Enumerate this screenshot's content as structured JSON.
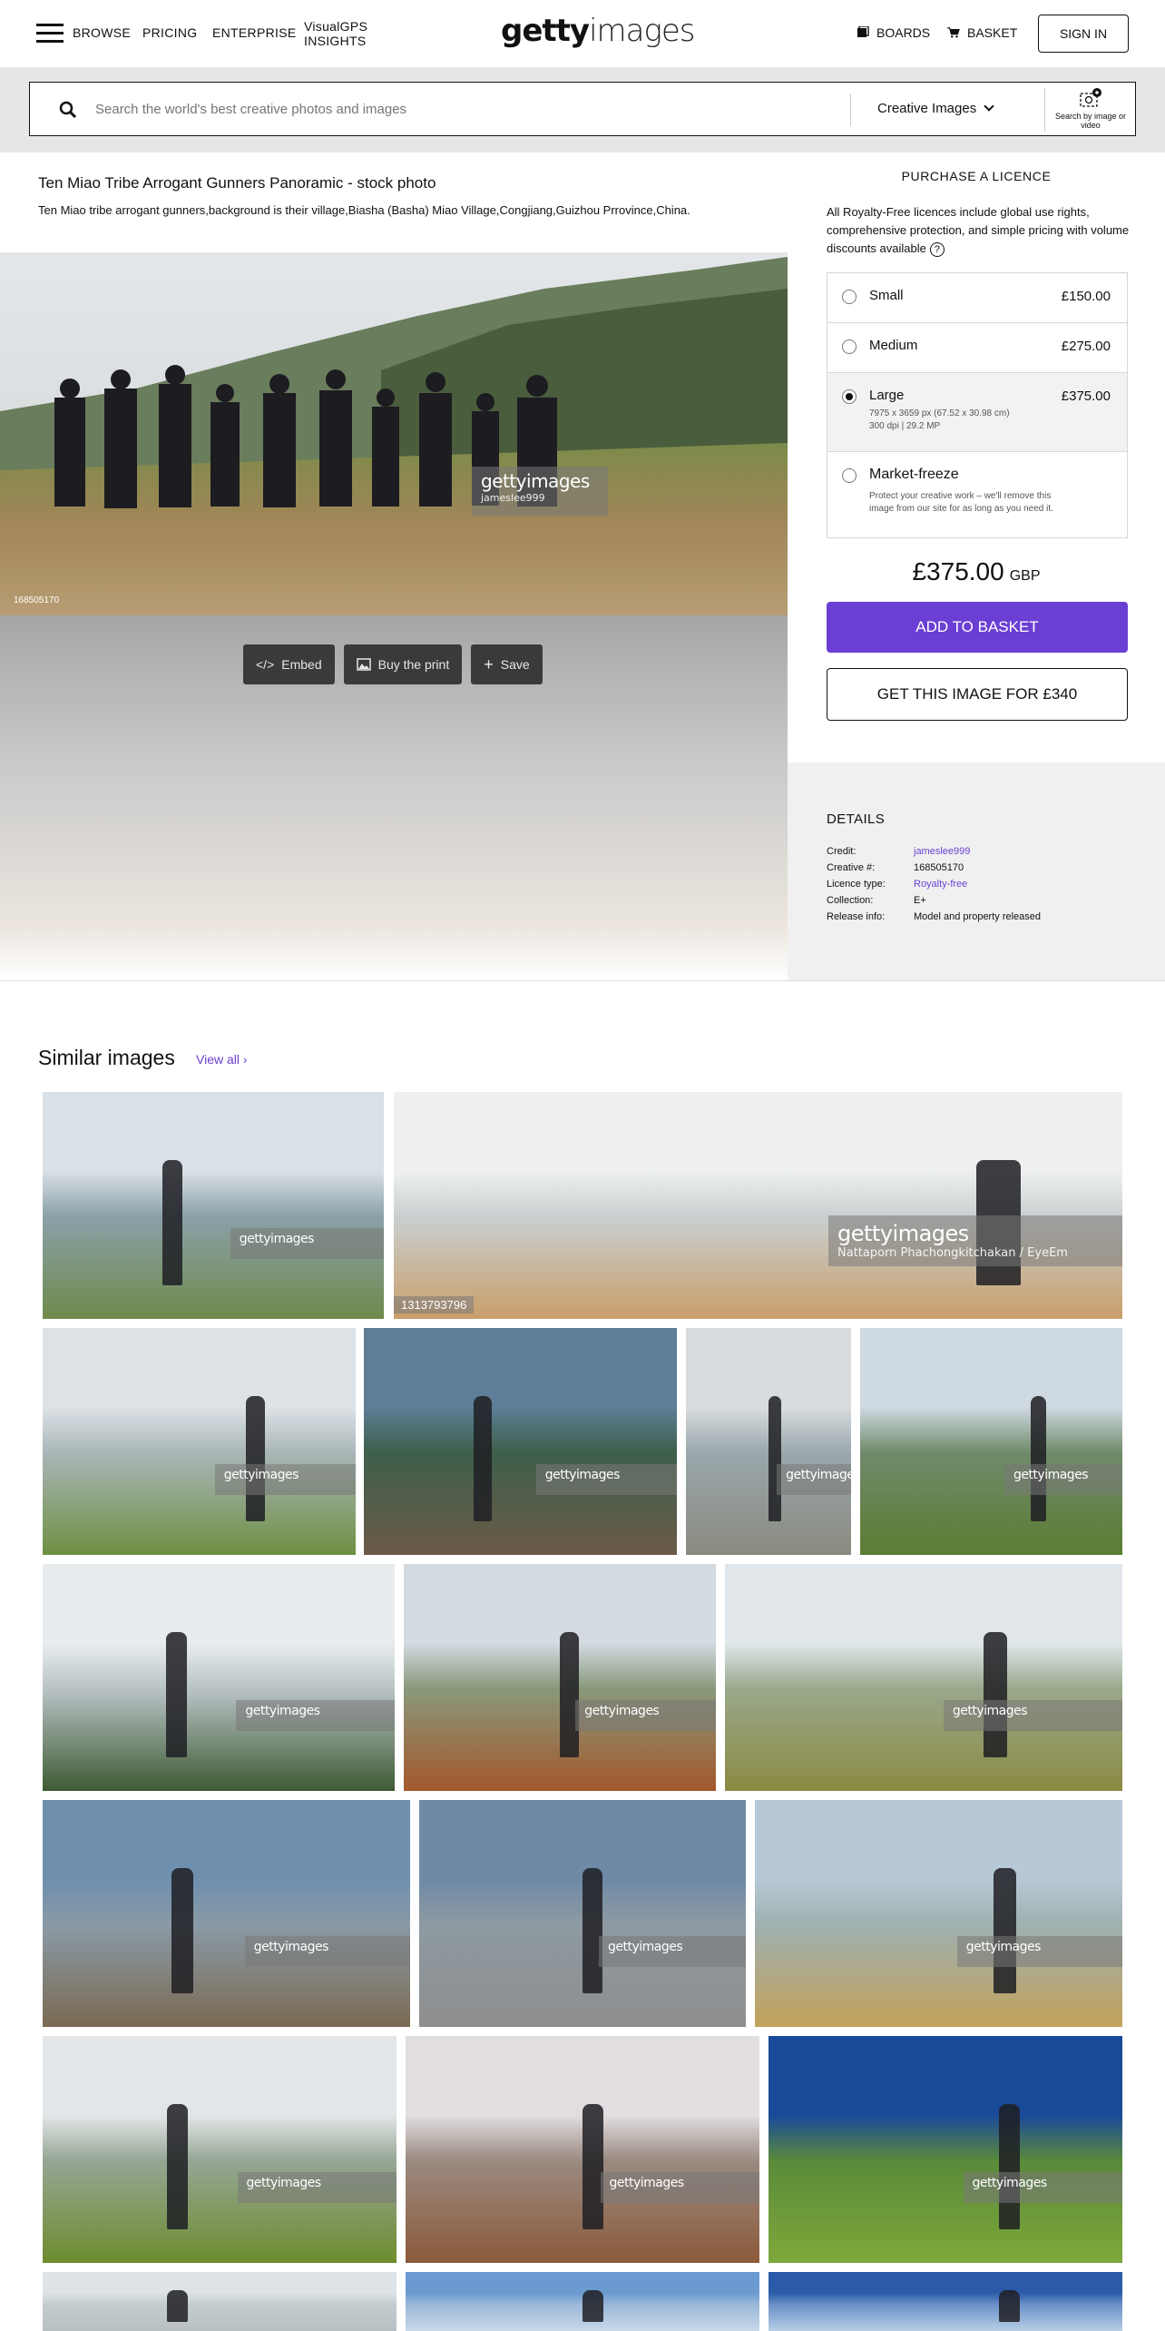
{
  "header": {
    "browse": "BROWSE",
    "pricing": "PRICING",
    "enterprise": "ENTERPRISE",
    "insights": "VisualGPS INSIGHTS",
    "logo_bold": "getty",
    "logo_light": "images",
    "boards": "BOARDS",
    "basket": "BASKET",
    "signin": "SIGN IN"
  },
  "search": {
    "placeholder": "Search the world's best creative photos and images",
    "type": "Creative Images",
    "by_image": "Search by image or video"
  },
  "photo": {
    "title": "Ten Miao Tribe Arrogant Gunners Panoramic - stock photo",
    "description": "Ten Miao tribe arrogant gunners,background is their village,Biasha (Basha) Miao Village,Congjiang,Guizhou Prrovince,China.",
    "watermark_logo": "gettyimages",
    "watermark_credit": "jameslee999",
    "image_id": "168505170"
  },
  "actions": {
    "embed": "Embed",
    "print": "Buy the print",
    "save": "Save"
  },
  "licence": {
    "heading": "PURCHASE A LICENCE",
    "info": "All Royalty-Free licences include global use rights, comprehensive protection, and simple pricing with volume discounts available",
    "sizes": [
      {
        "name": "Small",
        "price": "£150.00"
      },
      {
        "name": "Medium",
        "price": "£275.00"
      },
      {
        "name": "Large",
        "price": "£375.00",
        "meta1": "7975 x 3659 px (67.52 x 30.98 cm)",
        "meta2": "300 dpi | 29.2 MP",
        "selected": true
      },
      {
        "name": "Market-freeze",
        "price": "",
        "meta1": "Protect your creative work – we'll remove this",
        "meta2": "image from our site for as long as you need it."
      }
    ],
    "total_amount": "£375.00",
    "total_currency": "GBP",
    "add_basket": "ADD TO BASKET",
    "get_image": "GET THIS IMAGE FOR £340"
  },
  "details": {
    "title": "DETAILS",
    "rows": [
      {
        "key": "Credit:",
        "val": "jameslee999"
      },
      {
        "key": "Creative #:",
        "val": "168505170"
      },
      {
        "key": "Licence type:",
        "val": "Royalty-free"
      },
      {
        "key": "Collection:",
        "val": "E+"
      },
      {
        "key": "Release info:",
        "val": "Model and property released"
      }
    ]
  },
  "similar": {
    "title": "Similar images",
    "view_all": "View all",
    "watermark_logo": "gettyimages",
    "featured_credit": "Nattaporn Phachongkitchakan / EyeEm",
    "featured_id": "1313793796"
  },
  "colors": {
    "accent": "#6b3fd4",
    "search_band": "#e6e6e6",
    "details_bg": "#f0f0f0"
  }
}
